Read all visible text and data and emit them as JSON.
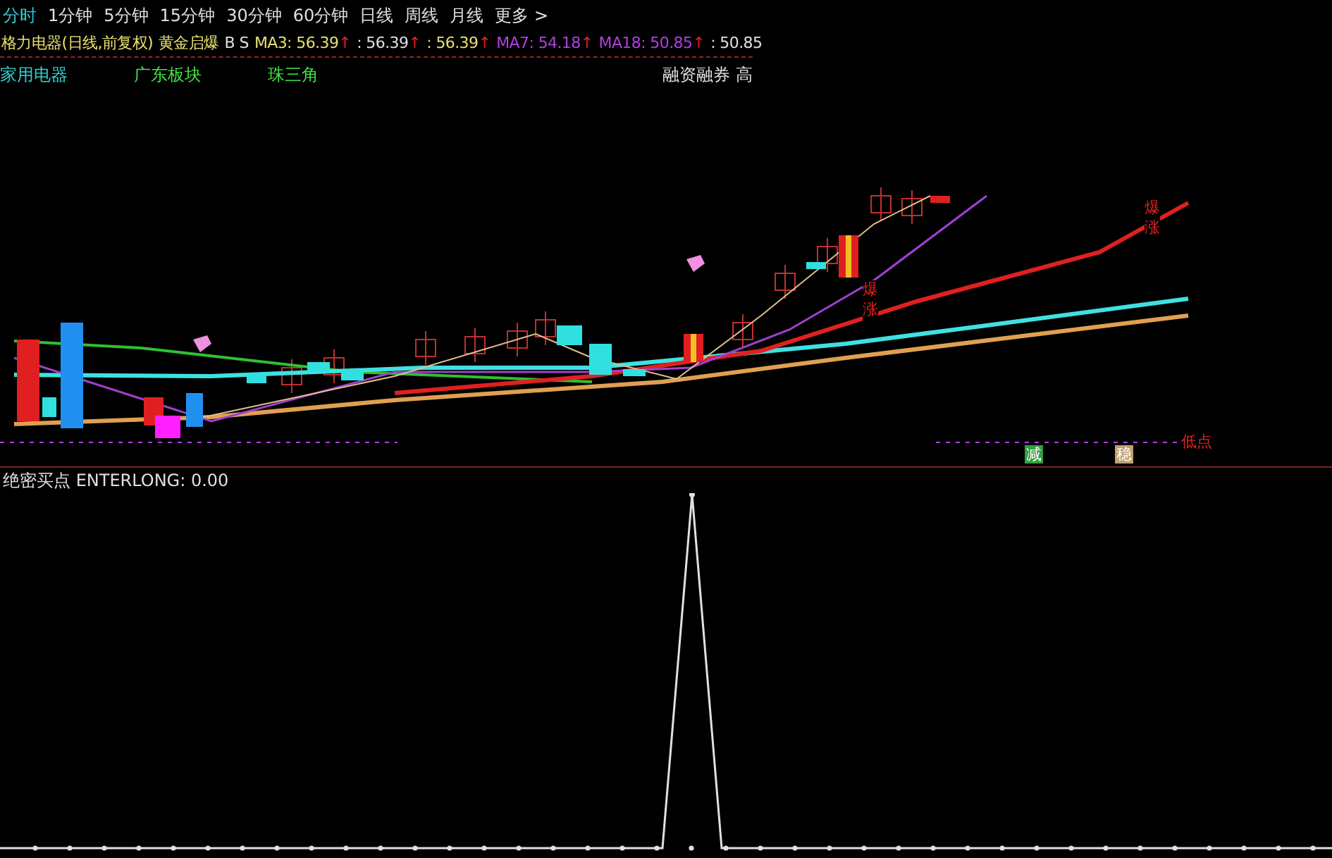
{
  "periods": [
    {
      "label": "分时",
      "selected": true
    },
    {
      "label": "1分钟",
      "selected": false
    },
    {
      "label": "5分钟",
      "selected": false
    },
    {
      "label": "15分钟",
      "selected": false
    },
    {
      "label": "30分钟",
      "selected": false
    },
    {
      "label": "60分钟",
      "selected": false
    },
    {
      "label": "日线",
      "selected": false
    },
    {
      "label": "周线",
      "selected": false
    },
    {
      "label": "月线",
      "selected": false
    },
    {
      "label": "更多 >",
      "selected": false
    }
  ],
  "title": "格力电器(日线,前复权)",
  "indicator_name": "黄金启爆",
  "signal_text": "B S",
  "legend": [
    {
      "label": "MA3: 56.39",
      "arrow": "↑",
      "color": "#e8e070"
    },
    {
      "label": ": 56.39",
      "arrow": "↑",
      "color": "#e0e0e0"
    },
    {
      "label": ": 56.39",
      "arrow": "↑",
      "color": "#e8e070"
    },
    {
      "label": "MA7: 54.18",
      "arrow": "↑",
      "color": "#b040e0"
    },
    {
      "label": "MA18: 50.85",
      "arrow": "↑",
      "color": "#b040e0"
    },
    {
      "label": ": 50.85",
      "color": "#e0e0e0"
    }
  ],
  "tags": [
    {
      "label": "家用电器",
      "color": "#30d0d0"
    },
    {
      "label": "广东板块",
      "color": "#40e040"
    },
    {
      "label": "珠三角",
      "color": "#40e040"
    }
  ],
  "tag_right": "融资融券 高",
  "chart_labels": [
    {
      "kind": "vertical",
      "text": "爆涨"
    },
    {
      "kind": "vertical",
      "text": "爆涨"
    },
    {
      "kind": "text",
      "text": "低点"
    },
    {
      "kind": "tag",
      "text": "减",
      "color": "#30a040"
    },
    {
      "kind": "tag",
      "text": "稳",
      "color": "#c0a070"
    }
  ],
  "sub_indicator": "绝密买点 ENTERLONG: 0.00"
}
